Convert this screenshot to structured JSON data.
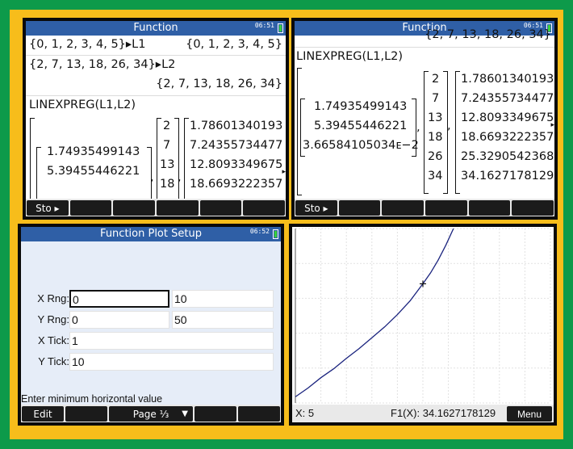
{
  "panels": {
    "top_left": {
      "title": "Function",
      "clock": "06:51",
      "history": {
        "line1_input": "{0, 1, 2, 3, 4, 5}▸L1",
        "line1_output": "{0, 1, 2, 3, 4, 5}",
        "line2_input": "{2, 7, 13, 18, 26, 34}▸L2",
        "line2_output": "{2, 7, 13, 18, 26, 34}",
        "line3_input": "LINEXPREG(L1,L2)",
        "result_coeffs": [
          "1.74935499143",
          "5.39455446221"
        ],
        "result_y": [
          "2",
          "7",
          "13",
          "18"
        ],
        "result_pred": [
          "1.78601340193",
          "7.24355734477",
          "12.8093349675",
          "18.6693222357"
        ],
        "comma": ","
      },
      "softkeys": [
        "Sto ▸",
        "",
        "",
        "",
        "",
        ""
      ]
    },
    "top_right": {
      "title": "Function",
      "clock": "06:51",
      "history": {
        "scrolled_line": "{2, 7, 13, 18, 26, 34}",
        "line3_input": "LINEXPREG(L1,L2)",
        "result_coeffs": [
          "1.74935499143",
          "5.39455446221",
          "3.66584105034ᴇ−2"
        ],
        "result_y": [
          "2",
          "7",
          "13",
          "18",
          "26",
          "34"
        ],
        "result_pred": [
          "1.78601340193",
          "7.24355734477",
          "12.8093349675",
          "18.6693222357",
          "25.3290542368",
          "34.1627178129"
        ],
        "comma": ","
      },
      "softkeys": [
        "Sto ▸",
        "",
        "",
        "",
        "",
        ""
      ]
    },
    "bottom_left": {
      "title": "Function Plot Setup",
      "clock": "06:52",
      "rows": [
        {
          "label": "X Rng:",
          "value1": "0",
          "value2": "10"
        },
        {
          "label": "Y Rng:",
          "value1": "0",
          "value2": "50"
        },
        {
          "label": "X Tick:",
          "value1": "1"
        },
        {
          "label": "Y Tick:",
          "value1": "10"
        }
      ],
      "help": "Enter minimum horizontal value",
      "softkeys": [
        "Edit",
        "",
        "Page ⅓",
        "▼",
        "",
        ""
      ]
    },
    "bottom_right": {
      "status_x": "X: 5",
      "status_fx": "F1(X): 34.1627178129",
      "menu": "Menu"
    }
  },
  "colors": {
    "outer": "#0d9a4a",
    "frame": "#f7bd1b",
    "titlebar": "#2f5fa6",
    "curve": "#1a237e"
  },
  "chart_data": {
    "type": "line",
    "xlim": [
      0,
      10
    ],
    "ylim": [
      0,
      50
    ],
    "grid": true,
    "x_tick": 1,
    "y_tick": 10,
    "series": [
      {
        "x": [
          0,
          0.5,
          1,
          1.5,
          2,
          2.5,
          3,
          3.5,
          4,
          4.5,
          5,
          5.3,
          5.6,
          5.9,
          6.2
        ],
        "values": [
          1.75,
          4.3,
          7.24,
          9.8,
          12.81,
          15.6,
          18.67,
          21.8,
          25.33,
          29.3,
          34.16,
          37.3,
          41.0,
          45.2,
          50.0
        ]
      }
    ],
    "trace_point": {
      "x": 5,
      "y": 34.1627178129
    }
  }
}
